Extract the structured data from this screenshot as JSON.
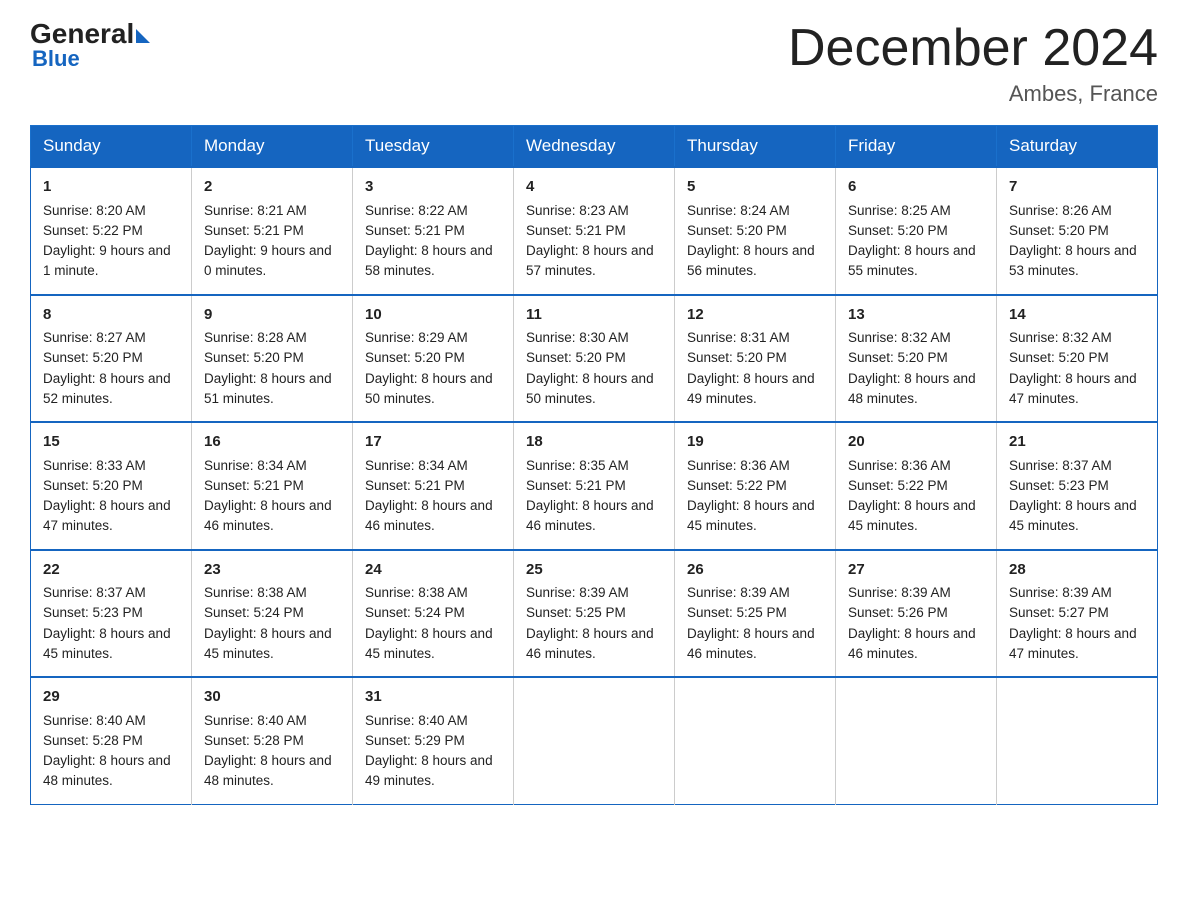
{
  "header": {
    "logo_general": "General",
    "logo_blue": "Blue",
    "month_title": "December 2024",
    "location": "Ambes, France"
  },
  "days_of_week": [
    "Sunday",
    "Monday",
    "Tuesday",
    "Wednesday",
    "Thursday",
    "Friday",
    "Saturday"
  ],
  "weeks": [
    [
      {
        "day": "1",
        "sunrise": "8:20 AM",
        "sunset": "5:22 PM",
        "daylight": "9 hours and 1 minute."
      },
      {
        "day": "2",
        "sunrise": "8:21 AM",
        "sunset": "5:21 PM",
        "daylight": "9 hours and 0 minutes."
      },
      {
        "day": "3",
        "sunrise": "8:22 AM",
        "sunset": "5:21 PM",
        "daylight": "8 hours and 58 minutes."
      },
      {
        "day": "4",
        "sunrise": "8:23 AM",
        "sunset": "5:21 PM",
        "daylight": "8 hours and 57 minutes."
      },
      {
        "day": "5",
        "sunrise": "8:24 AM",
        "sunset": "5:20 PM",
        "daylight": "8 hours and 56 minutes."
      },
      {
        "day": "6",
        "sunrise": "8:25 AM",
        "sunset": "5:20 PM",
        "daylight": "8 hours and 55 minutes."
      },
      {
        "day": "7",
        "sunrise": "8:26 AM",
        "sunset": "5:20 PM",
        "daylight": "8 hours and 53 minutes."
      }
    ],
    [
      {
        "day": "8",
        "sunrise": "8:27 AM",
        "sunset": "5:20 PM",
        "daylight": "8 hours and 52 minutes."
      },
      {
        "day": "9",
        "sunrise": "8:28 AM",
        "sunset": "5:20 PM",
        "daylight": "8 hours and 51 minutes."
      },
      {
        "day": "10",
        "sunrise": "8:29 AM",
        "sunset": "5:20 PM",
        "daylight": "8 hours and 50 minutes."
      },
      {
        "day": "11",
        "sunrise": "8:30 AM",
        "sunset": "5:20 PM",
        "daylight": "8 hours and 50 minutes."
      },
      {
        "day": "12",
        "sunrise": "8:31 AM",
        "sunset": "5:20 PM",
        "daylight": "8 hours and 49 minutes."
      },
      {
        "day": "13",
        "sunrise": "8:32 AM",
        "sunset": "5:20 PM",
        "daylight": "8 hours and 48 minutes."
      },
      {
        "day": "14",
        "sunrise": "8:32 AM",
        "sunset": "5:20 PM",
        "daylight": "8 hours and 47 minutes."
      }
    ],
    [
      {
        "day": "15",
        "sunrise": "8:33 AM",
        "sunset": "5:20 PM",
        "daylight": "8 hours and 47 minutes."
      },
      {
        "day": "16",
        "sunrise": "8:34 AM",
        "sunset": "5:21 PM",
        "daylight": "8 hours and 46 minutes."
      },
      {
        "day": "17",
        "sunrise": "8:34 AM",
        "sunset": "5:21 PM",
        "daylight": "8 hours and 46 minutes."
      },
      {
        "day": "18",
        "sunrise": "8:35 AM",
        "sunset": "5:21 PM",
        "daylight": "8 hours and 46 minutes."
      },
      {
        "day": "19",
        "sunrise": "8:36 AM",
        "sunset": "5:22 PM",
        "daylight": "8 hours and 45 minutes."
      },
      {
        "day": "20",
        "sunrise": "8:36 AM",
        "sunset": "5:22 PM",
        "daylight": "8 hours and 45 minutes."
      },
      {
        "day": "21",
        "sunrise": "8:37 AM",
        "sunset": "5:23 PM",
        "daylight": "8 hours and 45 minutes."
      }
    ],
    [
      {
        "day": "22",
        "sunrise": "8:37 AM",
        "sunset": "5:23 PM",
        "daylight": "8 hours and 45 minutes."
      },
      {
        "day": "23",
        "sunrise": "8:38 AM",
        "sunset": "5:24 PM",
        "daylight": "8 hours and 45 minutes."
      },
      {
        "day": "24",
        "sunrise": "8:38 AM",
        "sunset": "5:24 PM",
        "daylight": "8 hours and 45 minutes."
      },
      {
        "day": "25",
        "sunrise": "8:39 AM",
        "sunset": "5:25 PM",
        "daylight": "8 hours and 46 minutes."
      },
      {
        "day": "26",
        "sunrise": "8:39 AM",
        "sunset": "5:25 PM",
        "daylight": "8 hours and 46 minutes."
      },
      {
        "day": "27",
        "sunrise": "8:39 AM",
        "sunset": "5:26 PM",
        "daylight": "8 hours and 46 minutes."
      },
      {
        "day": "28",
        "sunrise": "8:39 AM",
        "sunset": "5:27 PM",
        "daylight": "8 hours and 47 minutes."
      }
    ],
    [
      {
        "day": "29",
        "sunrise": "8:40 AM",
        "sunset": "5:28 PM",
        "daylight": "8 hours and 48 minutes."
      },
      {
        "day": "30",
        "sunrise": "8:40 AM",
        "sunset": "5:28 PM",
        "daylight": "8 hours and 48 minutes."
      },
      {
        "day": "31",
        "sunrise": "8:40 AM",
        "sunset": "5:29 PM",
        "daylight": "8 hours and 49 minutes."
      },
      null,
      null,
      null,
      null
    ]
  ],
  "labels": {
    "sunrise_prefix": "Sunrise: ",
    "sunset_prefix": "Sunset: ",
    "daylight_prefix": "Daylight: "
  }
}
